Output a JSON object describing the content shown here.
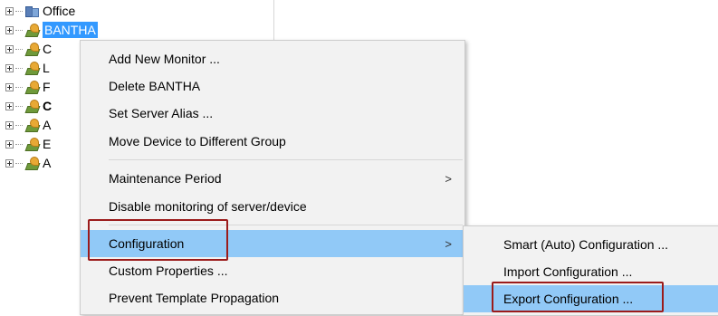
{
  "tree": {
    "nodes": [
      {
        "label": "Office",
        "icon": "office-group-icon",
        "selected": false,
        "bold": false
      },
      {
        "label": "BANTHA",
        "icon": "server-device-icon",
        "selected": true,
        "bold": false
      },
      {
        "label": "C",
        "icon": "server-device-icon",
        "selected": false,
        "bold": false
      },
      {
        "label": "L",
        "icon": "server-device-icon",
        "selected": false,
        "bold": false
      },
      {
        "label": "F",
        "icon": "server-device-icon",
        "selected": false,
        "bold": false
      },
      {
        "label": "C",
        "icon": "server-device-icon",
        "selected": false,
        "bold": true
      },
      {
        "label": "A",
        "icon": "server-device-icon",
        "selected": false,
        "bold": false
      },
      {
        "label": "E",
        "icon": "server-device-icon",
        "selected": false,
        "bold": false
      },
      {
        "label": "A",
        "icon": "server-device-icon",
        "selected": false,
        "bold": false
      }
    ]
  },
  "context_menu": {
    "items": [
      {
        "label": "Add New Monitor ..."
      },
      {
        "label": "Delete BANTHA"
      },
      {
        "label": "Set Server Alias ..."
      },
      {
        "label": "Move Device to Different Group"
      },
      {
        "label": "Maintenance Period",
        "submenu_arrow": ">"
      },
      {
        "label": "Disable monitoring of server/device"
      },
      {
        "label": "Configuration",
        "submenu_arrow": ">"
      },
      {
        "label": "Custom Properties ..."
      },
      {
        "label": "Prevent Template Propagation"
      }
    ]
  },
  "submenu": {
    "items": [
      {
        "label": "Smart (Auto) Configuration ..."
      },
      {
        "label": "Import Configuration ..."
      },
      {
        "label": "Export Configuration ..."
      }
    ]
  },
  "colors": {
    "highlight": "#91c9f7",
    "selection": "#3399ff",
    "callout": "#9b1b1b"
  }
}
